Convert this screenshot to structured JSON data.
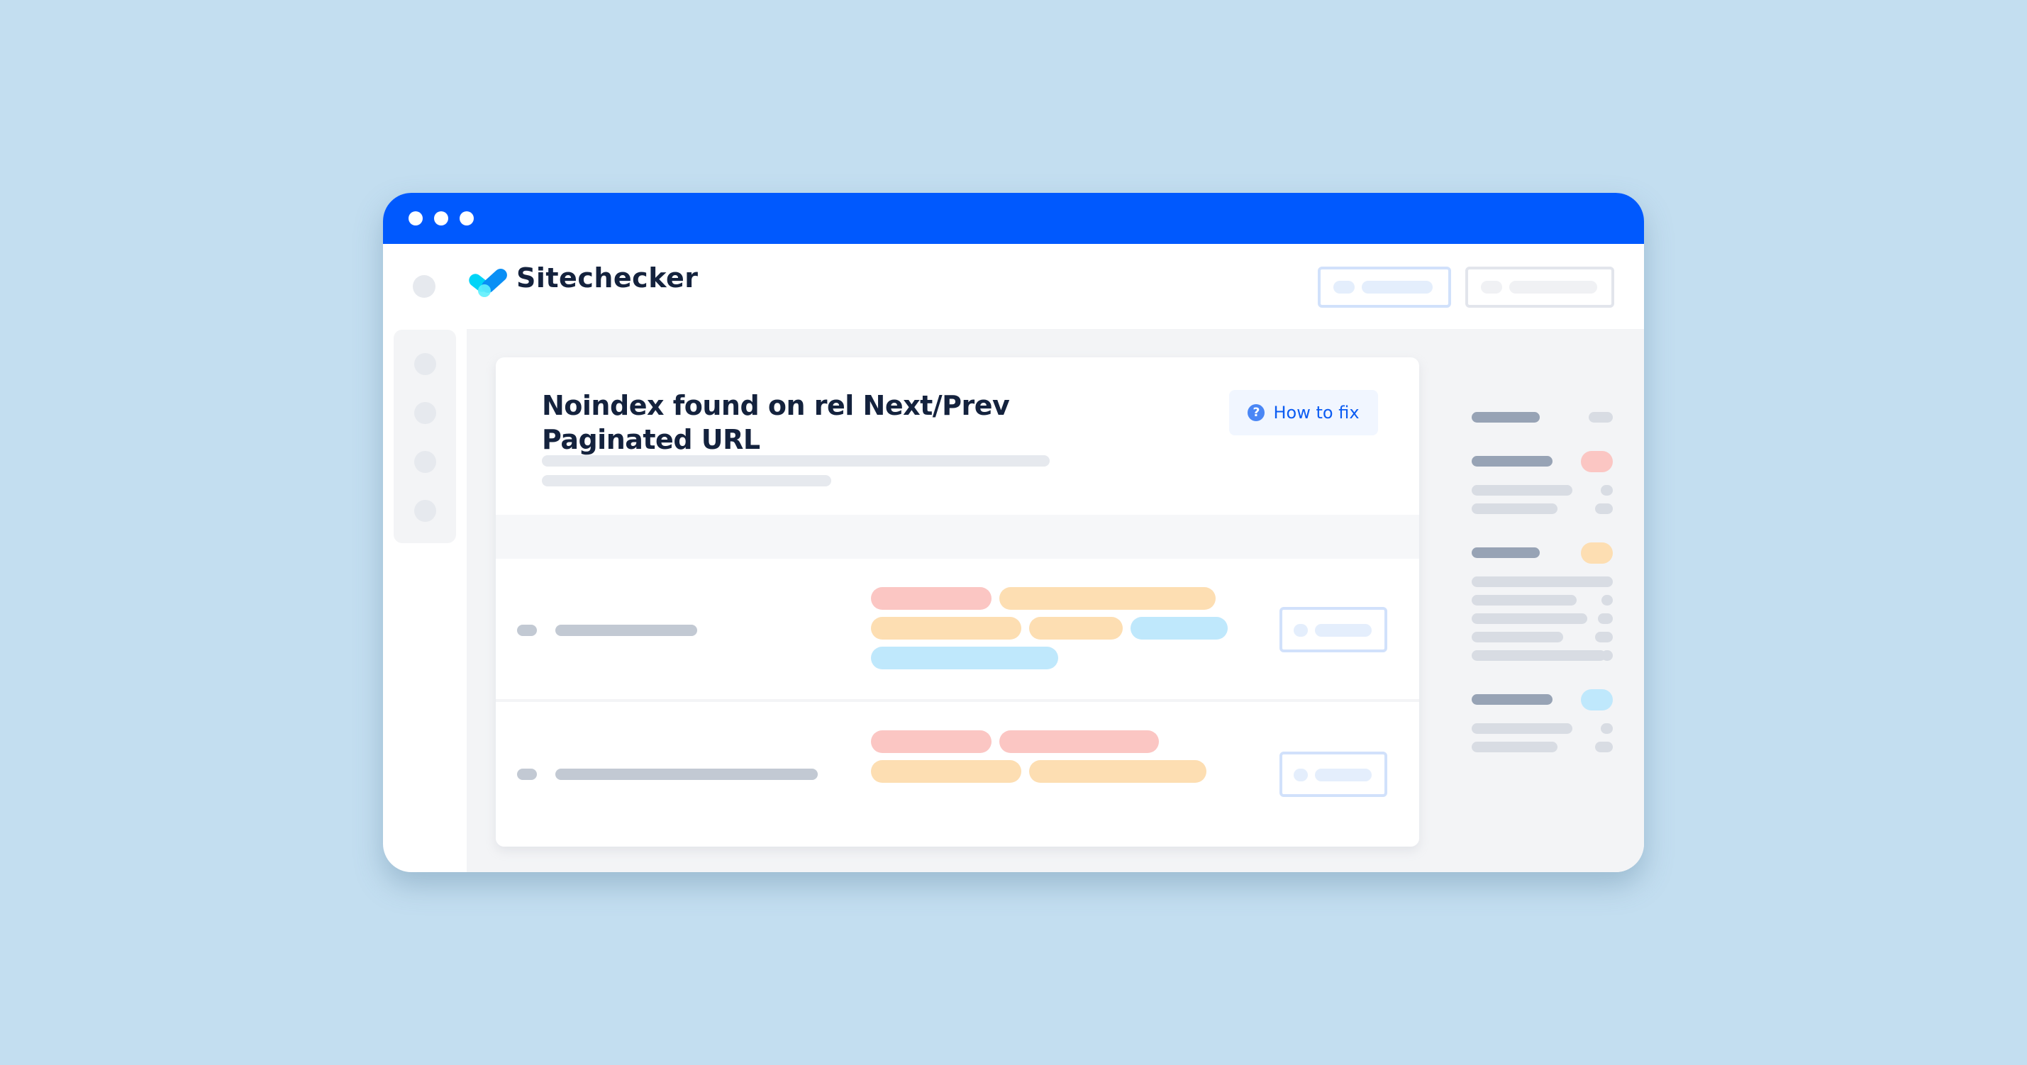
{
  "window": {
    "titlebar_color": "#0059fe",
    "controls": [
      "window-dot",
      "window-dot",
      "window-dot"
    ]
  },
  "header": {
    "brand": "Sitechecker",
    "logo_icon": "checkmark-logo-icon",
    "buttons": [
      {
        "name": "primary-header-button",
        "style": "primary"
      },
      {
        "name": "secondary-header-button",
        "style": "secondary"
      }
    ]
  },
  "sidebar": {
    "items": [
      "nav-item",
      "nav-item",
      "nav-item",
      "nav-item"
    ]
  },
  "card": {
    "title": "Noindex found on rel Next/Prev Paginated URL",
    "how_to_fix": {
      "label": "How to fix",
      "icon": "question-circle-icon"
    },
    "rows": [
      {
        "tags": [
          [
            "red",
            "orange"
          ],
          [
            "orange",
            "orange",
            "blue"
          ],
          [
            "blue"
          ]
        ]
      },
      {
        "tags": [
          [
            "red",
            "red"
          ],
          [
            "orange",
            "orange"
          ]
        ]
      }
    ]
  },
  "right_panel": {
    "groups": [
      {
        "badge": "neutral",
        "badge_color": "#d8dce3",
        "items": 0
      },
      {
        "badge": "error",
        "badge_color": "#fbc6c3",
        "items": 2
      },
      {
        "badge": "warning",
        "badge_color": "#fddeb2",
        "items": 5
      },
      {
        "badge": "notice",
        "badge_color": "#bfe8fc",
        "items": 2
      }
    ]
  },
  "colors": {
    "background": "#c3def0",
    "brand_blue": "#0059fe",
    "title_text": "#14223d",
    "link_blue": "#0c5cf2",
    "tag_red": "#fbc6c3",
    "tag_orange": "#fddeb2",
    "tag_blue": "#bfe8fc"
  }
}
